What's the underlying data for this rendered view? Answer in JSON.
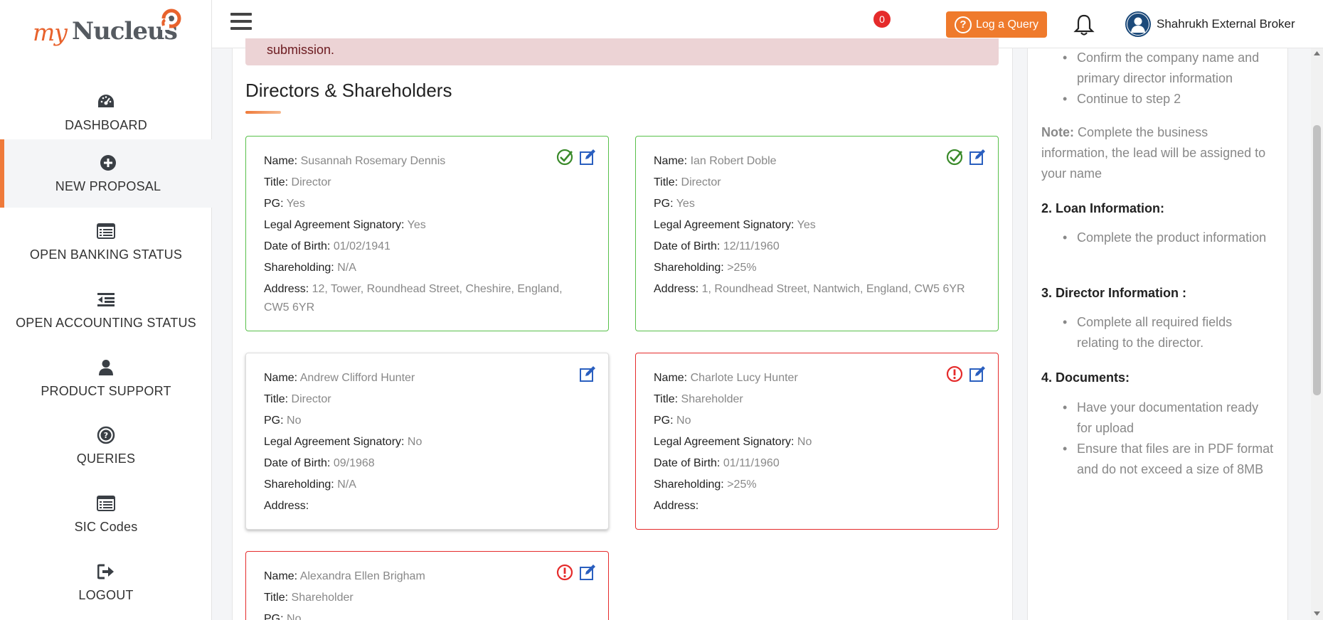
{
  "brand": {
    "logo_my": "my",
    "logo_nucleus": "Nucleus"
  },
  "sidebar": {
    "items": [
      {
        "label": "DASHBOARD",
        "icon": "dashboard-icon"
      },
      {
        "label": "NEW PROPOSAL",
        "icon": "plus-circle-icon",
        "active": true
      },
      {
        "label": "OPEN BANKING STATUS",
        "icon": "list-icon"
      },
      {
        "label": "OPEN ACCOUNTING STATUS",
        "icon": "indent-list-icon"
      },
      {
        "label": "PRODUCT SUPPORT",
        "icon": "user-icon"
      },
      {
        "label": "QUERIES",
        "icon": "question-circle-icon"
      },
      {
        "label": "SIC Codes",
        "icon": "list-icon"
      },
      {
        "label": "LOGOUT",
        "icon": "logout-icon"
      }
    ]
  },
  "topbar": {
    "query_label": "Log a Query",
    "notification_count": "0",
    "user_name": "Shahrukh External Broker"
  },
  "alert": {
    "text": "submission."
  },
  "section": {
    "title": "Directors & Shareholders"
  },
  "labels": {
    "name": "Name:",
    "title": "Title:",
    "pg": "PG:",
    "signatory": "Legal Agreement Signatory:",
    "dob": "Date of Birth:",
    "shareholding": "Shareholding:",
    "address": "Address:"
  },
  "cards": [
    {
      "status": "complete",
      "name": "Susannah Rosemary Dennis",
      "title": "Director",
      "pg": "Yes",
      "signatory": "Yes",
      "dob": "01/02/1941",
      "shareholding": "N/A",
      "address": "12, Tower, Roundhead Street, Cheshire, England, CW5 6YR"
    },
    {
      "status": "complete",
      "name": "Ian Robert Doble",
      "title": "Director",
      "pg": "Yes",
      "signatory": "Yes",
      "dob": "12/11/1960",
      "shareholding": ">25%",
      "address": "1, Roundhead Street, Nantwich, England, CW5 6YR"
    },
    {
      "status": "pending",
      "name": "Andrew Clifford Hunter",
      "title": "Director",
      "pg": "No",
      "signatory": "No",
      "dob": "09/1968",
      "shareholding": "N/A",
      "address": ""
    },
    {
      "status": "error",
      "name": "Charlote Lucy Hunter",
      "title": "Shareholder",
      "pg": "No",
      "signatory": "No",
      "dob": "01/11/1960",
      "shareholding": ">25%",
      "address": ""
    },
    {
      "status": "error",
      "name": "Alexandra Ellen Brigham",
      "title": "Shareholder",
      "pg": "No"
    }
  ],
  "guide": {
    "step1_bullets": [
      "Confirm the company name and primary director information",
      "Continue to step 2"
    ],
    "note_label": "Note:",
    "note_text": "Complete the business information, the lead will be assigned to your name",
    "step2_heading": "2. Loan Information:",
    "step2_bullets": [
      "Complete the product information"
    ],
    "step3_heading": "3. Director Information :",
    "step3_bullets": [
      "Complete all required fields relating to the director."
    ],
    "step4_heading": "4. Documents:",
    "step4_bullets": [
      "Have your documentation ready for upload",
      "Ensure that files are in PDF format and do not exceed a size of 8MB"
    ]
  },
  "colors": {
    "accent": "#ef7a2c",
    "success": "#58c04a",
    "error": "#e52b2b",
    "edit": "#2a5fbf"
  }
}
